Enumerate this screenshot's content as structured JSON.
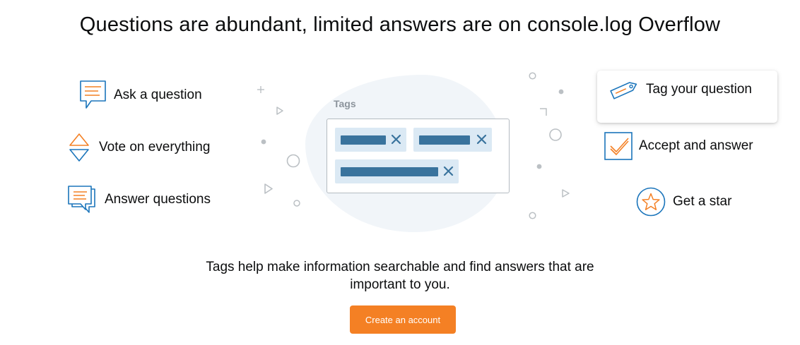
{
  "headline": "Questions are abundant, limited answers are on console.log Overflow",
  "left_features": [
    {
      "label": "Ask a question",
      "icon": "speech-bubble-icon"
    },
    {
      "label": "Vote on everything",
      "icon": "vote-arrows-icon"
    },
    {
      "label": "Answer questions",
      "icon": "answer-bubbles-icon"
    }
  ],
  "right_features": [
    {
      "label": "Tag your question",
      "icon": "tag-icon"
    },
    {
      "label": "Accept and answer",
      "icon": "checkmark-icon"
    },
    {
      "label": "Get a star",
      "icon": "star-icon"
    }
  ],
  "tags_illustration": {
    "title": "Tags",
    "remove_glyph": "×"
  },
  "footer": {
    "text": "Tags help make information searchable and find answers that are important to you."
  },
  "cta": {
    "label": "Create an account"
  },
  "colors": {
    "accent_orange": "#f48024",
    "icon_blue": "#1b75bb",
    "tag_chip_bg": "#dbe9f4",
    "tag_chip_bar": "#39739d",
    "blob": "#f1f5f9"
  }
}
